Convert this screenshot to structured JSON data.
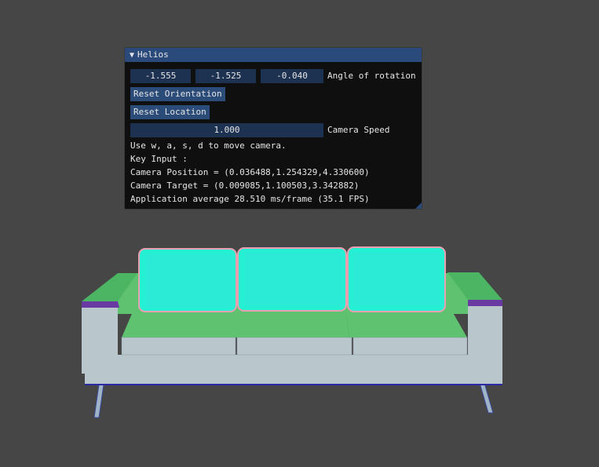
{
  "window": {
    "title": "Helios",
    "rotation": [
      "-1.555",
      "-1.525",
      "-0.040"
    ],
    "rotation_label": "Angle of rotation",
    "reset_orientation": "Reset Orientation",
    "reset_location": "Reset Location",
    "camera_speed": "1.000",
    "camera_speed_label": "Camera Speed",
    "help_text": "Use w, a, s, d to move camera.",
    "key_input": "Key Input :",
    "camera_position": "Camera Position = (0.036488,1.254329,4.330600)",
    "camera_target": "Camera Target = (0.009085,1.100503,3.342882)",
    "perf": "Application average 28.510 ms/frame (35.1 FPS)"
  },
  "colors": {
    "background": "#464646",
    "panel_bg": "#0f0f0f",
    "title_bar": "#294a7a",
    "button": "#2b4c78",
    "field": "#1d3150",
    "cushion_back": "#26f0d4",
    "cushion_seat": "#5ec270",
    "sofa_body": "#b9c6cc",
    "armrest_top": "#6a3aa3"
  }
}
